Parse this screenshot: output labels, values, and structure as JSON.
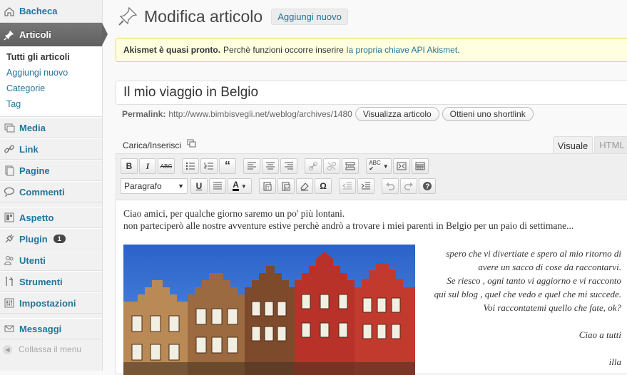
{
  "sidebar": {
    "items": [
      {
        "label": "Bacheca",
        "icon": "dashboard-icon"
      },
      {
        "label": "Articoli",
        "icon": "pushpin-icon"
      },
      {
        "label": "Media",
        "icon": "media-icon"
      },
      {
        "label": "Link",
        "icon": "link-icon"
      },
      {
        "label": "Pagine",
        "icon": "pages-icon"
      },
      {
        "label": "Commenti",
        "icon": "comments-icon"
      },
      {
        "label": "Aspetto",
        "icon": "appearance-icon"
      },
      {
        "label": "Plugin",
        "icon": "plugin-icon",
        "badge": "1"
      },
      {
        "label": "Utenti",
        "icon": "users-icon"
      },
      {
        "label": "Strumenti",
        "icon": "tools-icon"
      },
      {
        "label": "Impostazioni",
        "icon": "settings-icon"
      },
      {
        "label": "Messaggi",
        "icon": "messages-icon"
      }
    ],
    "submenu": [
      "Tutti gli articoli",
      "Aggiungi nuovo",
      "Categorie",
      "Tag"
    ],
    "collapse": "Collassa il menu"
  },
  "header": {
    "title": "Modifica articolo",
    "add_new": "Aggiungi nuovo"
  },
  "notice": {
    "bold": "Akismet è quasi pronto.",
    "text": "Perchè funzioni occorre inserire",
    "link": "la propria chiave API Akismet",
    "end": "."
  },
  "post": {
    "title": "Il mio viaggio in Belgio",
    "permalink_label": "Permalink:",
    "permalink_url": "http://www.bimbisvegli.net/weblog/archives/1480",
    "view_button": "Visualizza articolo",
    "shortlink_button": "Ottieni uno shortlink"
  },
  "editor": {
    "upload_label": "Carica/Inserisci",
    "tab_visual": "Visuale",
    "tab_html": "HTML",
    "format": "Paragrafo",
    "paragraph1": "Ciao amici, per qualche giorno saremo un po' più lontani.",
    "paragraph2": "non parteciperò alle nostre avventure estive  perchè andrò a trovare  i miei parenti in Belgio per un paio di settimane...",
    "side_lines": [
      "spero che vi divertiate e spero al mio ritorno di",
      "avere un sacco di cose da raccontarvi.",
      "Se riesco , ogni tanto vi aggiorno e vi racconto",
      "qui sul blog , quel che  vedo e quel che  mi succede.",
      "Voi raccontatemi quello che fate, ok?",
      "",
      "Ciao a tutti",
      "",
      "illa"
    ]
  },
  "colors": {
    "link": "#21759b",
    "notice_bg": "#ffffe0",
    "active_menu": "#6d6d6d"
  }
}
